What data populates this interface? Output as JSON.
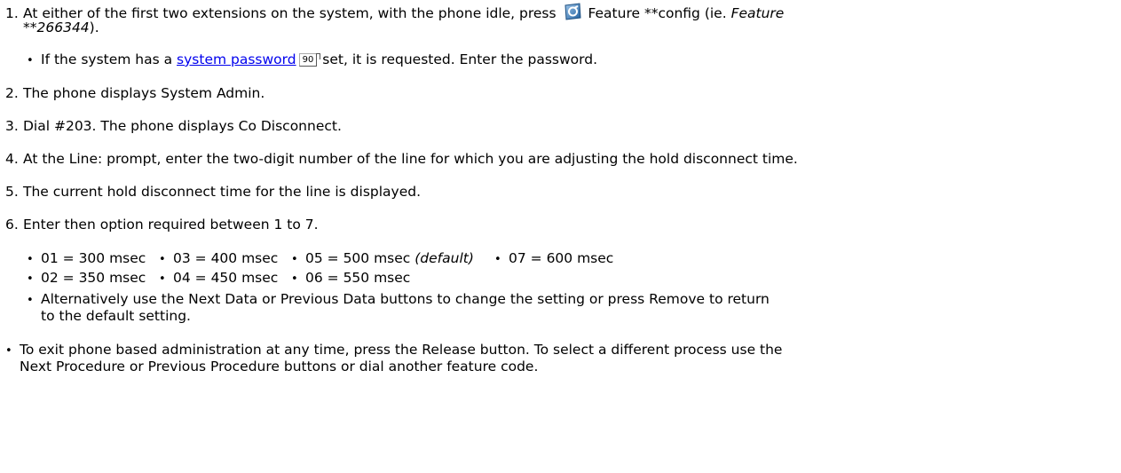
{
  "steps": [
    {
      "num": "1.",
      "pre": "At either of the first two extensions on the system, with the phone idle, press",
      "icon": "feature-button-icon",
      "post": " Feature **config (ie. ",
      "italic": "Feature",
      "cont_italic": "**266344",
      "cont_end": ")."
    },
    {
      "num": "2.",
      "text": "The phone displays System Admin."
    },
    {
      "num": "3.",
      "text": "Dial #203. The phone displays Co Disconnect."
    },
    {
      "num": "4.",
      "text": "At the Line: prompt, enter the two-digit number of the line for which you are adjusting the hold disconnect time."
    },
    {
      "num": "5.",
      "text": "The current hold disconnect time for the line is displayed."
    },
    {
      "num": "6.",
      "text": "Enter then option required between 1 to 7."
    }
  ],
  "password_note": {
    "pre": "If the system has a ",
    "link": "system password",
    "ref": "90",
    "post": " set, it is requested. Enter the password."
  },
  "options": [
    {
      "label": "01 = 300 msec"
    },
    {
      "label": "02 = 350 msec"
    },
    {
      "label": "03 = 400 msec"
    },
    {
      "label": "04 = 450 msec"
    },
    {
      "label": "05 = 500 msec ",
      "note": "(default)"
    },
    {
      "label": "06 = 550 msec"
    },
    {
      "label": "07 = 600 msec"
    }
  ],
  "alt_note": {
    "line1": "Alternatively use the Next Data or Previous Data buttons to change the setting or press Remove to return",
    "line2": "to the default setting."
  },
  "exit_note": {
    "line1": "To exit phone based administration at any time, press the Release button. To select a different process use the",
    "line2": "Next Procedure or Previous Procedure buttons or dial another feature code."
  },
  "bullet": "•",
  "colors": {
    "link": "#0000ee",
    "icon_blue": "#2a6fb5"
  }
}
